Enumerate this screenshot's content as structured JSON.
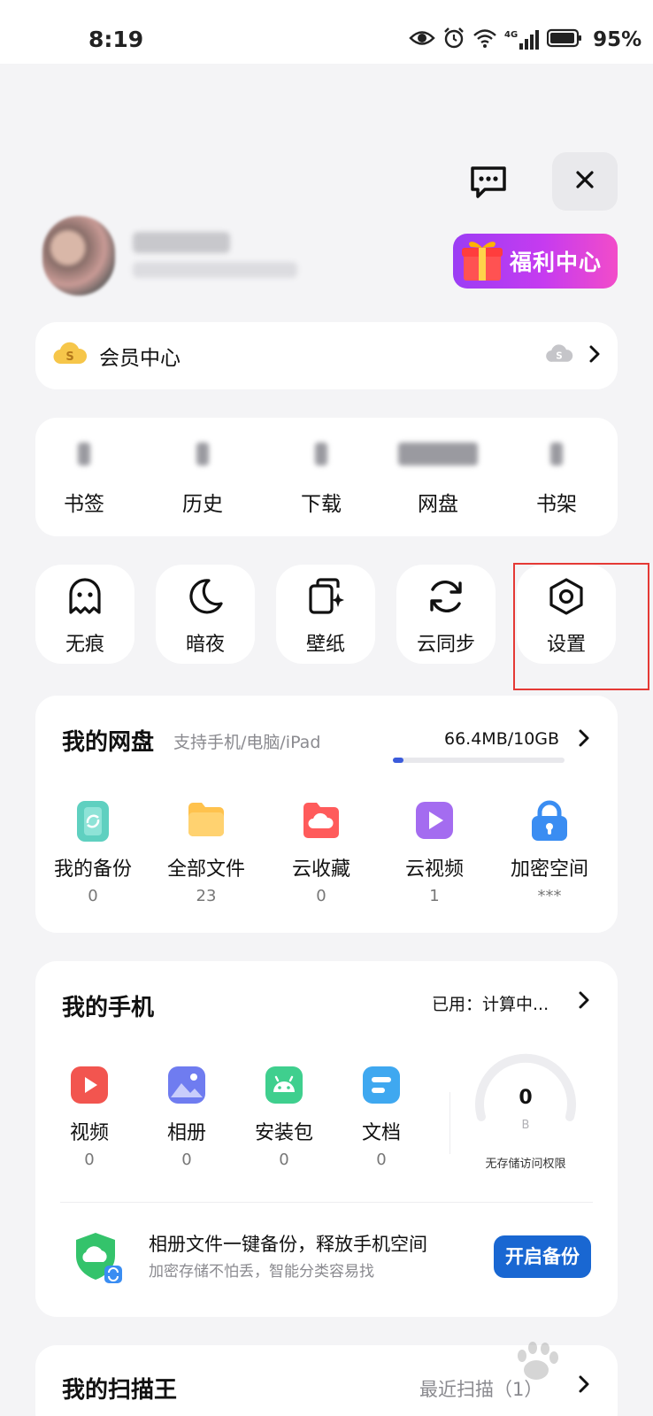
{
  "status_bar": {
    "time": "8:19",
    "network": "4G",
    "battery": "95%",
    "icons": [
      "eye-icon",
      "alarm-icon",
      "wifi-icon",
      "signal-icon",
      "battery-icon"
    ]
  },
  "header": {
    "message_icon": "message-icon",
    "close_icon": "close-icon"
  },
  "profile": {
    "welfare_label": "福利中心"
  },
  "vip": {
    "label": "会员中心"
  },
  "quick_links": [
    {
      "label": "书签"
    },
    {
      "label": "历史"
    },
    {
      "label": "下载"
    },
    {
      "label": "网盘"
    },
    {
      "label": "书架"
    }
  ],
  "tools": [
    {
      "label": "无痕",
      "icon": "ghost-icon"
    },
    {
      "label": "暗夜",
      "icon": "moon-icon"
    },
    {
      "label": "壁纸",
      "icon": "wallpaper-icon"
    },
    {
      "label": "云同步",
      "icon": "sync-icon"
    },
    {
      "label": "设置",
      "icon": "settings-icon"
    }
  ],
  "cloud_disk": {
    "title": "我的网盘",
    "subtitle": "支持手机/电脑/iPad",
    "storage": "66.4MB/10GB",
    "usage_fraction": 0.0065,
    "items": [
      {
        "label": "我的备份",
        "count": "0",
        "color": "#5fd0c0"
      },
      {
        "label": "全部文件",
        "count": "23",
        "color": "#ffc24d"
      },
      {
        "label": "云收藏",
        "count": "0",
        "color": "#ff5b5b"
      },
      {
        "label": "云视频",
        "count": "1",
        "color": "#a46cf0"
      },
      {
        "label": "加密空间",
        "count": "***",
        "color": "#3a8df2"
      }
    ]
  },
  "my_phone": {
    "title": "我的手机",
    "used_label": "已用：计算中...",
    "items": [
      {
        "label": "视频",
        "count": "0",
        "color": "#f2554f"
      },
      {
        "label": "相册",
        "count": "0",
        "color": "#6f7cf0"
      },
      {
        "label": "安装包",
        "count": "0",
        "color": "#3fcf8e"
      },
      {
        "label": "文档",
        "count": "0",
        "color": "#3fa8f0"
      }
    ],
    "gauge_value": "0",
    "gauge_unit": "B",
    "gauge_note": "无存储访问权限",
    "backup_title": "相册文件一键备份，释放手机空间",
    "backup_subtitle": "加密存储不怕丢，智能分类容易找",
    "backup_button": "开启备份"
  },
  "scanner": {
    "title": "我的扫描王",
    "recent": "最近扫描（1）"
  }
}
